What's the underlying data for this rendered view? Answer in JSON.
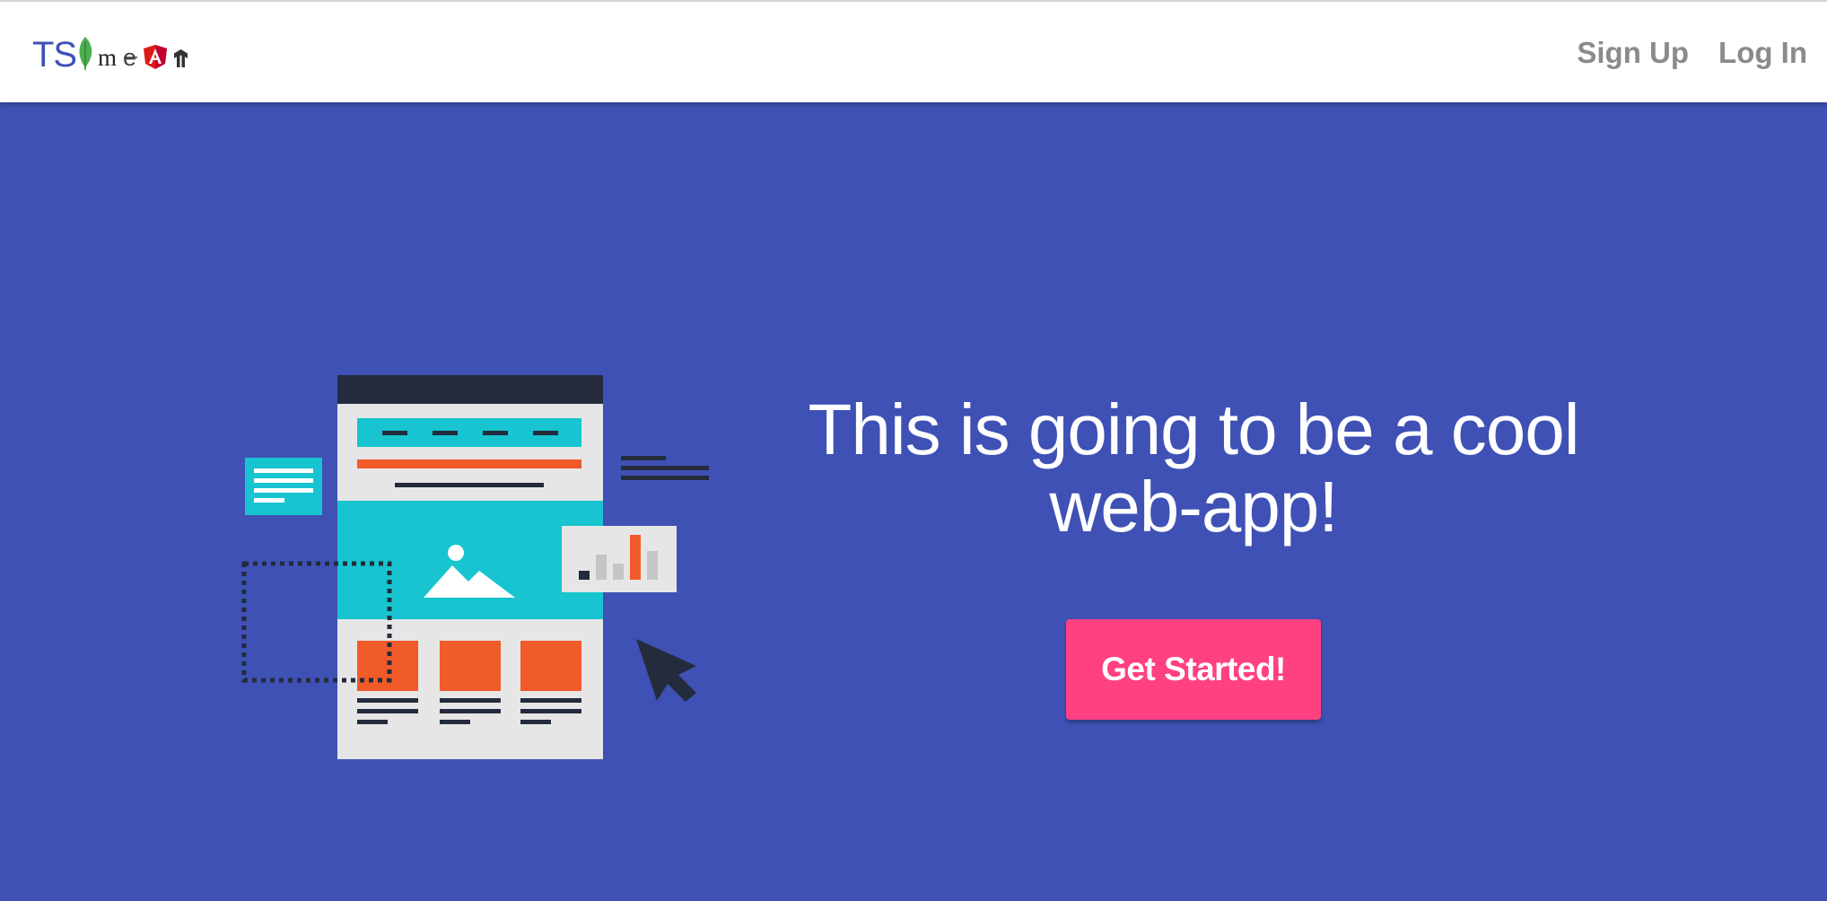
{
  "header": {
    "logo_text": "TS",
    "logo_alt_parts": [
      "mongo-leaf",
      "m",
      "e",
      "angular-A",
      "node-n"
    ],
    "nav": {
      "signup_label": "Sign Up",
      "login_label": "Log In"
    }
  },
  "hero": {
    "headline": "This is going to be a cool web-app!",
    "cta_label": "Get Started!",
    "illustration": "website-wireframe-illustration"
  },
  "colors": {
    "primary": "#3f51b5",
    "accent": "#ff4081",
    "nav_text": "#8a8a8a",
    "illustration_dark": "#232b3d",
    "illustration_teal": "#17c4cf",
    "illustration_orange": "#f15a29",
    "illustration_gray": "#e6e6e6"
  }
}
